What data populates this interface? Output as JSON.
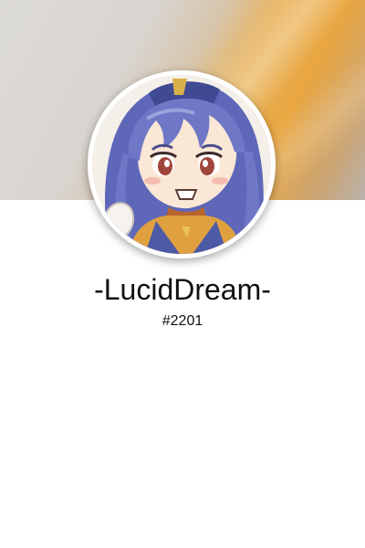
{
  "profile": {
    "username": "-LucidDream-",
    "discriminator": "#2201",
    "avatar_icon": "anime-girl-avatar",
    "banner_colors": [
      "#dddbd8",
      "#e9a640",
      "#b9b3ad"
    ]
  }
}
